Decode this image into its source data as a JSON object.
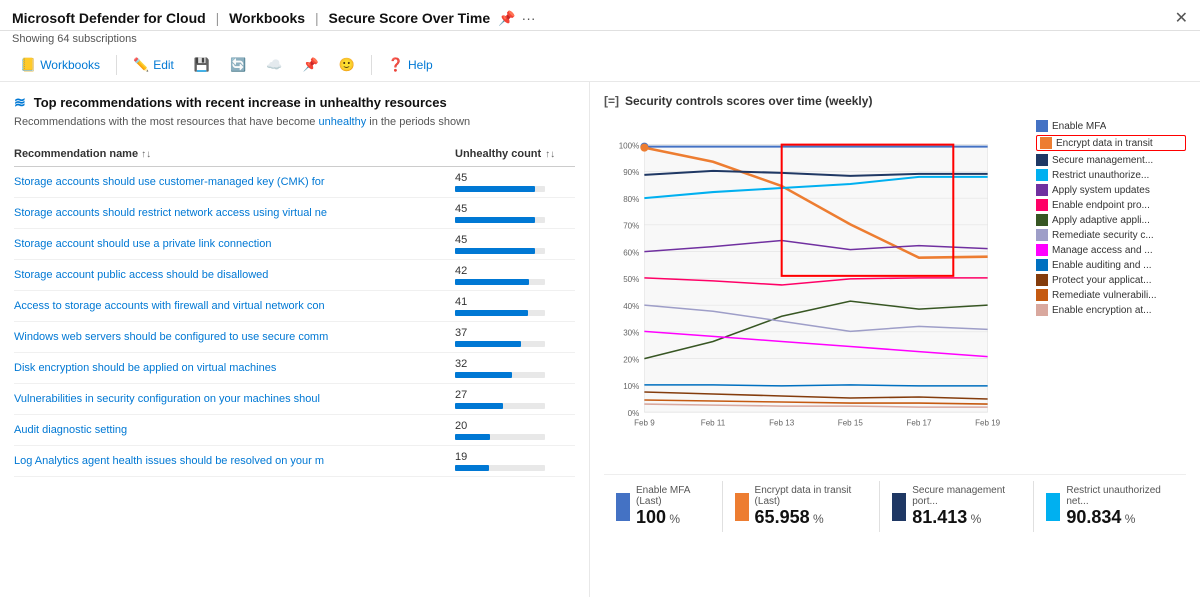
{
  "titleBar": {
    "appName": "Microsoft Defender for Cloud",
    "sep1": "|",
    "section": "Workbooks",
    "sep2": "|",
    "page": "Secure Score Over Time",
    "subtitle": "Showing 64 subscriptions"
  },
  "toolbar": {
    "items": [
      {
        "id": "workbooks",
        "icon": "📒",
        "label": "Workbooks"
      },
      {
        "id": "edit",
        "icon": "✏️",
        "label": "Edit"
      },
      {
        "id": "save",
        "icon": "💾",
        "label": ""
      },
      {
        "id": "refresh",
        "icon": "🔄",
        "label": ""
      },
      {
        "id": "cloud",
        "icon": "☁️",
        "label": ""
      },
      {
        "id": "pin",
        "icon": "📌",
        "label": ""
      },
      {
        "id": "smiley",
        "icon": "🙂",
        "label": ""
      },
      {
        "id": "help-q",
        "icon": "❓",
        "label": "Help"
      }
    ]
  },
  "leftPanel": {
    "sectionTitle": "Top recommendations with recent increase in unhealthy resources",
    "sectionSubtitle": "Recommendations with the most resources that have become unhealthy in the periods shown",
    "tableHeader": {
      "nameCol": "Recommendation name",
      "countCol": "Unhealthy count"
    },
    "rows": [
      {
        "name": "Storage accounts should use customer-managed key (CMK) for",
        "count": 45,
        "barPct": 100
      },
      {
        "name": "Storage accounts should restrict network access using virtual ne",
        "count": 45,
        "barPct": 100
      },
      {
        "name": "Storage account should use a private link connection",
        "count": 45,
        "barPct": 100
      },
      {
        "name": "Storage account public access should be disallowed",
        "count": 42,
        "barPct": 93
      },
      {
        "name": "Access to storage accounts with firewall and virtual network con",
        "count": 41,
        "barPct": 91
      },
      {
        "name": "Windows web servers should be configured to use secure comm",
        "count": 37,
        "barPct": 82
      },
      {
        "name": "Disk encryption should be applied on virtual machines",
        "count": 32,
        "barPct": 71
      },
      {
        "name": "Vulnerabilities in security configuration on your machines shoul",
        "count": 27,
        "barPct": 60
      },
      {
        "name": "Audit diagnostic setting",
        "count": 20,
        "barPct": 44
      },
      {
        "name": "Log Analytics agent health issues should be resolved on your m",
        "count": 19,
        "barPct": 42
      }
    ]
  },
  "rightPanel": {
    "chartTitle": "Security controls scores over time (weekly)",
    "legend": [
      {
        "label": "Enable MFA",
        "color": "#4472C4",
        "highlighted": false
      },
      {
        "label": "Encrypt data in transit",
        "color": "#ED7D31",
        "highlighted": true
      },
      {
        "label": "Secure management...",
        "color": "#1F3864",
        "highlighted": false
      },
      {
        "label": "Restrict unauthorize...",
        "color": "#00B0F0",
        "highlighted": false
      },
      {
        "label": "Apply system updates",
        "color": "#7030A0",
        "highlighted": false
      },
      {
        "label": "Enable endpoint pro...",
        "color": "#FF0066",
        "highlighted": false
      },
      {
        "label": "Apply adaptive appli...",
        "color": "#375623",
        "highlighted": false
      },
      {
        "label": "Remediate security c...",
        "color": "#9E9EC8",
        "highlighted": false
      },
      {
        "label": "Manage access and ...",
        "color": "#FF00FF",
        "highlighted": false
      },
      {
        "label": "Enable auditing and ...",
        "color": "#0070C0",
        "highlighted": false
      },
      {
        "label": "Protect your applicat...",
        "color": "#843C0C",
        "highlighted": false
      },
      {
        "label": "Remediate vulnerabili...",
        "color": "#C55A11",
        "highlighted": false
      },
      {
        "label": "Enable encryption at...",
        "color": "#D9A89E",
        "highlighted": false
      }
    ],
    "xLabels": [
      "Feb 9",
      "Feb 11",
      "Feb 13",
      "Feb 15",
      "Feb 17",
      "Feb 19"
    ],
    "yLabels": [
      "0%",
      "10%",
      "20%",
      "30%",
      "40%",
      "50%",
      "60%",
      "70%",
      "80%",
      "90%",
      "100%"
    ],
    "footer": [
      {
        "label": "Enable MFA (Last)",
        "color": "#4472C4",
        "value": "100",
        "suffix": "%"
      },
      {
        "label": "Encrypt data in transit (Last)",
        "color": "#ED7D31",
        "value": "65.958",
        "suffix": "%"
      },
      {
        "label": "Secure management port...",
        "color": "#1F3864",
        "value": "81.413",
        "suffix": "%"
      },
      {
        "label": "Restrict unauthorized net...",
        "color": "#00B0F0",
        "value": "90.834",
        "suffix": "%"
      }
    ]
  }
}
